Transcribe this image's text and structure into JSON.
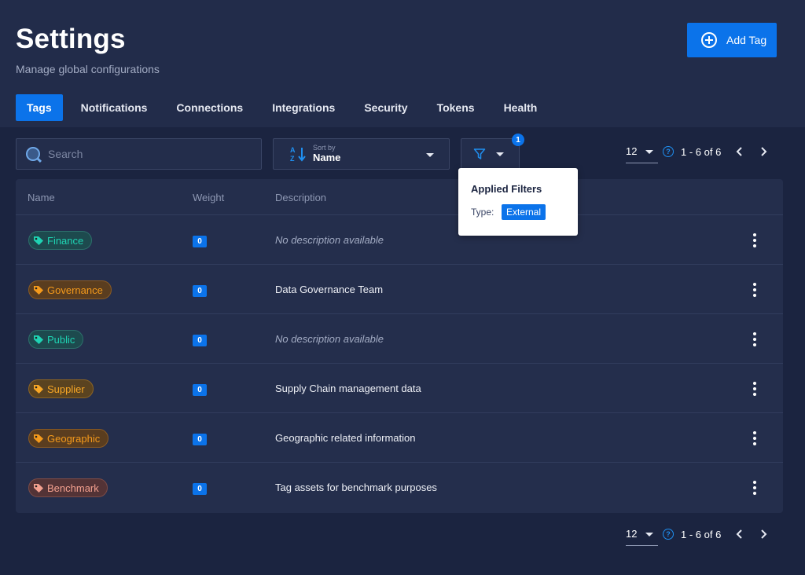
{
  "header": {
    "title": "Settings",
    "subtitle": "Manage global configurations",
    "add_button_label": "Add Tag"
  },
  "tabs": [
    {
      "label": "Tags",
      "active": true
    },
    {
      "label": "Notifications",
      "active": false
    },
    {
      "label": "Connections",
      "active": false
    },
    {
      "label": "Integrations",
      "active": false
    },
    {
      "label": "Security",
      "active": false
    },
    {
      "label": "Tokens",
      "active": false
    },
    {
      "label": "Health",
      "active": false
    }
  ],
  "toolbar": {
    "search_placeholder": "Search",
    "sort_caption": "Sort by",
    "sort_value": "Name",
    "filter_count": "1"
  },
  "pagination": {
    "page_size": "12",
    "range": "1 - 6 of 6"
  },
  "filter_popover": {
    "title": "Applied Filters",
    "label": "Type:",
    "value": "External"
  },
  "table": {
    "columns": [
      "Name",
      "Weight",
      "Description"
    ],
    "rows": [
      {
        "name": "Finance",
        "weight": "0",
        "description": "No description available",
        "empty": true,
        "text_color": "#1fd3b3",
        "bg_color": "#1d4a4e",
        "border_color": "#2c6f6b"
      },
      {
        "name": "Governance",
        "weight": "0",
        "description": "Data Governance Team",
        "empty": false,
        "text_color": "#f49a1c",
        "bg_color": "#5a3d1f",
        "border_color": "#8a5a23"
      },
      {
        "name": "Public",
        "weight": "0",
        "description": "No description available",
        "empty": true,
        "text_color": "#1fd3b3",
        "bg_color": "#1d4a4e",
        "border_color": "#2c6f6b"
      },
      {
        "name": "Supplier",
        "weight": "0",
        "description": "Supply Chain management data",
        "empty": false,
        "text_color": "#f8a726",
        "bg_color": "#5a4320",
        "border_color": "#8c6424"
      },
      {
        "name": "Geographic",
        "weight": "0",
        "description": "Geographic related information",
        "empty": false,
        "text_color": "#f49a1c",
        "bg_color": "#5a3d1f",
        "border_color": "#8a5a23"
      },
      {
        "name": "Benchmark",
        "weight": "0",
        "description": "Tag assets for benchmark purposes",
        "empty": false,
        "text_color": "#f3a08f",
        "bg_color": "#533336",
        "border_color": "#7c4b47"
      }
    ]
  },
  "icons": {
    "add": "plus-circle-icon",
    "search": "search-icon",
    "sort": "sort-alpha-icon",
    "filter": "filter-icon",
    "tag": "tag-icon",
    "help": "help-circle-icon",
    "more": "kebab-icon"
  },
  "colors": {
    "background": "#1b2440",
    "header": "#222c4a",
    "accent": "#0b73ea"
  }
}
